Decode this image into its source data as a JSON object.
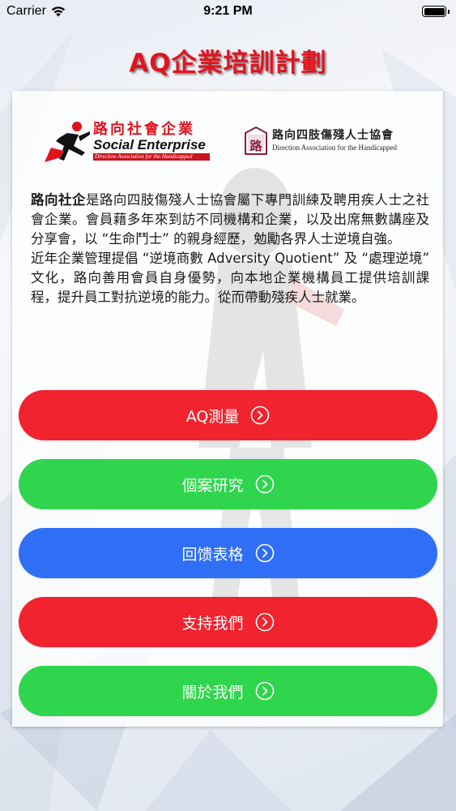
{
  "status_bar": {
    "carrier": "Carrier",
    "time": "9:21 PM",
    "battery_level": 1.0
  },
  "header": {
    "title": "AQ企業培訓計劃"
  },
  "logos": {
    "social_enterprise": {
      "chinese": "路向社會企業",
      "english": "Social Enterprise",
      "subtitle": "Direction Association for the Handicapped"
    },
    "association": {
      "chinese": "路向四肢傷殘人士協會",
      "english": "Direction Association for the Handicapped",
      "emblem_char": "路"
    }
  },
  "intro": {
    "p1_bold": "路向社企",
    "p1_rest": "是路向四肢傷殘人士協會屬下專門訓練及聘用疾人士之社會企業。會員藉多年來到訪不同機構和企業，以及出席無數講座及分享會，以 “生命鬥士” 的親身經歷，勉勵各界人士逆境自強。",
    "p2": "近年企業管理提倡 “逆境商數 Adversity Quotient” 及 “處理逆境” 文化，路向善用會員自身優勢，向本地企業機構員工提供培訓課程，提升員工對抗逆境的能力。從而帶動殘疾人士就業。"
  },
  "menu": {
    "buttons": [
      {
        "label": "AQ測量",
        "color": "#f0232f",
        "icon": "chevron-right-circle-icon"
      },
      {
        "label": "個案研究",
        "color": "#2fd64d",
        "icon": "chevron-right-circle-icon"
      },
      {
        "label": "回馈表格",
        "color": "#2f6ff6",
        "icon": "chevron-right-circle-icon"
      },
      {
        "label": "支持我們",
        "color": "#f0232f",
        "icon": "chevron-right-circle-icon"
      },
      {
        "label": "關於我們",
        "color": "#2fd64d",
        "icon": "chevron-right-circle-icon"
      }
    ]
  },
  "colors": {
    "title_red": "#e0141e",
    "brand_red": "#c8141c"
  }
}
